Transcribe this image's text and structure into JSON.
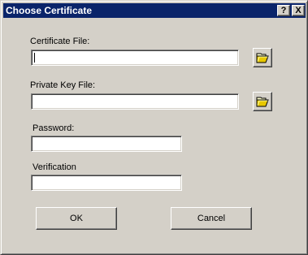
{
  "window": {
    "title": "Choose Certificate",
    "help_label": "?",
    "close_label": "X"
  },
  "form": {
    "certificate_file_label": "Certificate File:",
    "certificate_file_value": "",
    "private_key_file_label": "Private Key File:",
    "private_key_file_value": "",
    "password_label": "Password:",
    "password_value": "",
    "verification_label": "Verification",
    "verification_value": ""
  },
  "icons": {
    "browse": "open-folder-icon"
  },
  "buttons": {
    "ok_label": "OK",
    "cancel_label": "Cancel"
  }
}
